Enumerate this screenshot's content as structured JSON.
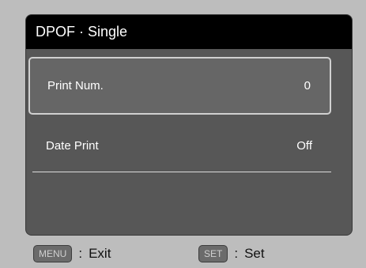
{
  "title": "DPOF · Single",
  "menu": {
    "items": [
      {
        "label": "Print Num.",
        "value": "0",
        "selected": true
      },
      {
        "label": "Date Print",
        "value": "Off",
        "selected": false
      }
    ]
  },
  "footer": {
    "exit_key": "MENU",
    "exit_label": "Exit",
    "set_key": "SET",
    "set_label": "Set",
    "separator": ":"
  }
}
